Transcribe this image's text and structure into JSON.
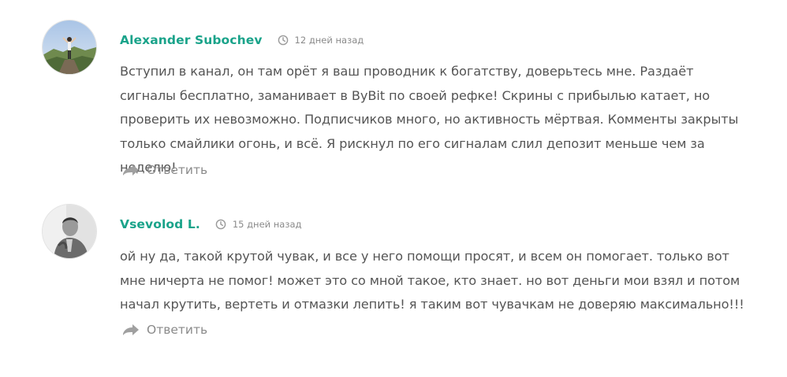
{
  "comments": [
    {
      "author": "Alexander Subochev",
      "time": "12 дней назад",
      "text": "Вступил в канал, он там орёт я ваш проводник к богатству, доверьтесь мне. Раздаёт сигналы бесплатно, заманивает в ByBit по своей рефке! Скрины с прибылью катает, но проверить их невозможно. Подписчиков много, но активность мёртвая. Комменты закрыты только смайлики огонь, и всё. Я рискнул по его сигналам слил депозит меньше чем за неделю!",
      "reply_label": "Ответить",
      "avatar_icon": "mountain-photo"
    },
    {
      "author": "Vsevolod L.",
      "time": "15 дней назад",
      "text": "ой ну да, такой крутой чувак, и все у него помощи просят, и всем он помогает. только вот мне ничерта не помог! может это со мной такое, кто знает. но вот деньги мои взял и потом начал крутить, вертеть и отмазки лепить! я таким вот чувачкам не доверяю максимально!!!",
      "reply_label": "Ответить",
      "avatar_icon": "person-bw-photo"
    }
  ],
  "colors": {
    "author": "#1aa38a",
    "text": "#555555",
    "meta": "#8a8a8a"
  }
}
